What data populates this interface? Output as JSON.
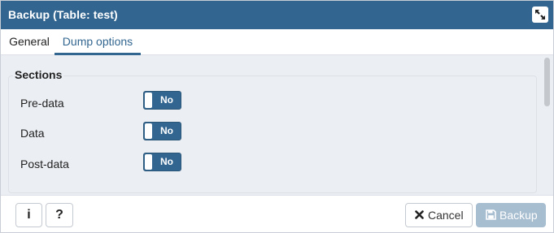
{
  "window": {
    "title": "Backup (Table: test)",
    "maximize_icon": "expand-arrows-icon"
  },
  "tabs": [
    {
      "label": "General",
      "active": false
    },
    {
      "label": "Dump options",
      "active": true
    }
  ],
  "sections": {
    "legend": "Sections",
    "rows": [
      {
        "label": "Pre-data",
        "toggle": "No"
      },
      {
        "label": "Data",
        "toggle": "No"
      },
      {
        "label": "Post-data",
        "toggle": "No"
      }
    ]
  },
  "footer": {
    "info_label": "i",
    "help_label": "?",
    "cancel_label": "Cancel",
    "cancel_icon": "x-icon",
    "backup_label": "Backup",
    "backup_icon": "floppy-disk-icon",
    "backup_enabled": false
  },
  "colors": {
    "accent": "#326690",
    "disabled_button": "#a7bdd0",
    "content_bg": "#ebeef3"
  }
}
